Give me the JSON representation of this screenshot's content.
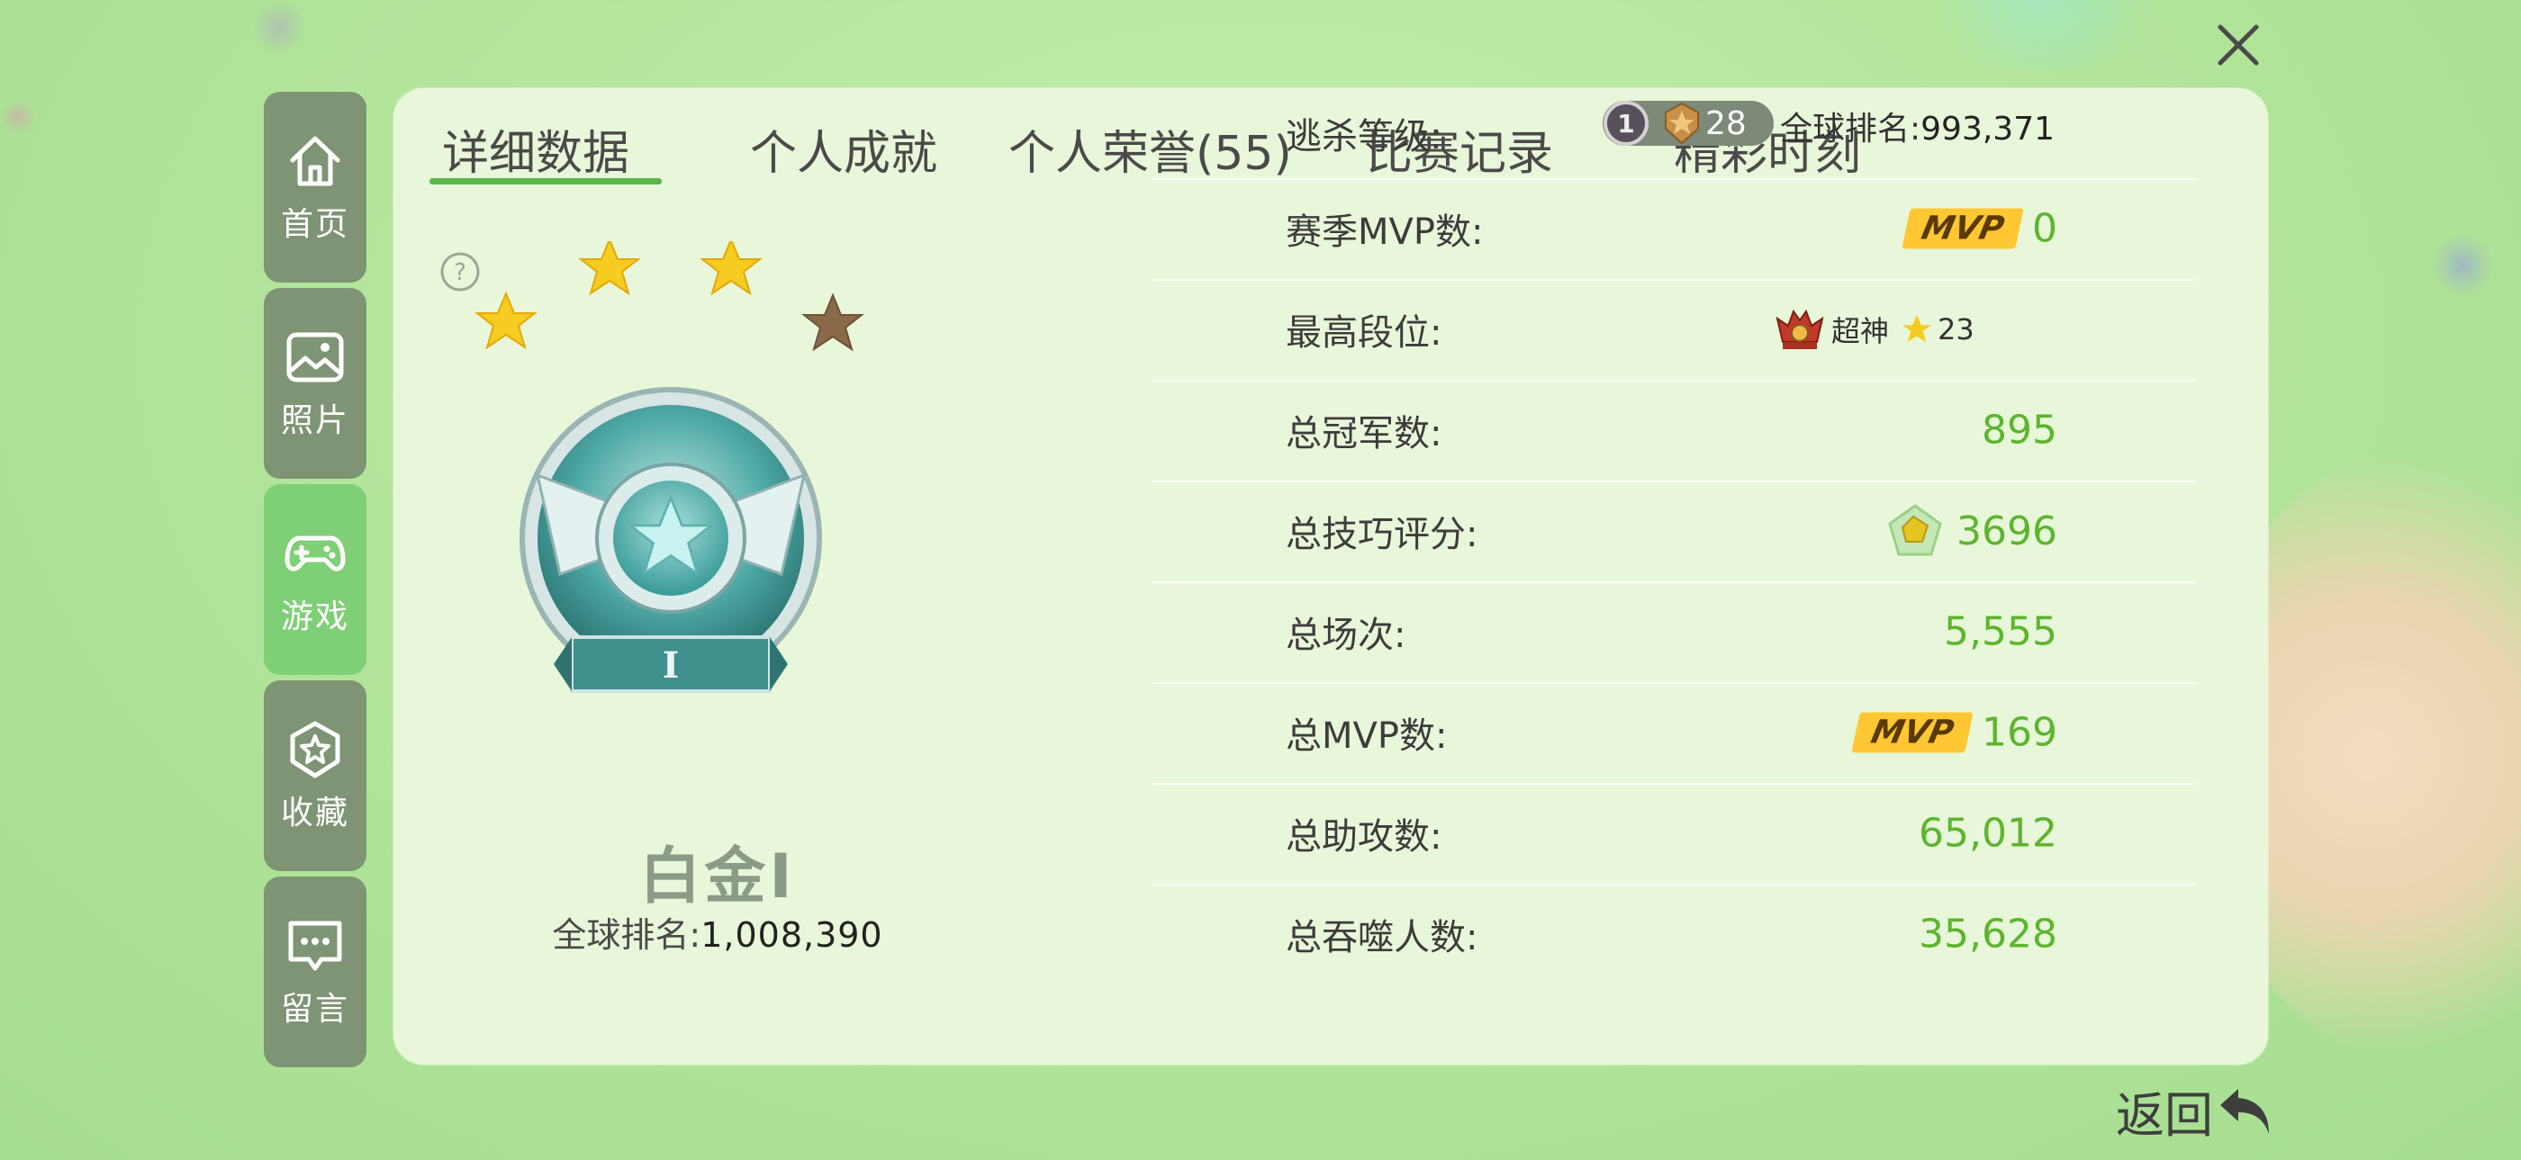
{
  "colors": {
    "accent": "#58b94a",
    "value_green": "#5cb52e",
    "sidebar_bg": "#7f9474",
    "sidebar_active": "#7fcf76",
    "panel_bg": "#e8f7d9",
    "mvp_badge": "#ffc832"
  },
  "sidebar": {
    "items": [
      {
        "label": "首页",
        "icon": "home-icon",
        "active": false
      },
      {
        "label": "照片",
        "icon": "photo-icon",
        "active": false
      },
      {
        "label": "游戏",
        "icon": "gamepad-icon",
        "active": true
      },
      {
        "label": "收藏",
        "icon": "star-badge-icon",
        "active": false
      },
      {
        "label": "留言",
        "icon": "message-icon",
        "active": false
      }
    ]
  },
  "tabs": [
    {
      "label": "详细数据",
      "active": true
    },
    {
      "label": "个人成就",
      "active": false
    },
    {
      "label": "个人荣誉(55)",
      "active": false
    },
    {
      "label": "比赛记录",
      "active": false
    },
    {
      "label": "精彩时刻",
      "active": false
    }
  ],
  "rank": {
    "stars_filled": 4,
    "stars_gold": 3,
    "emblem_numeral": "I",
    "name": "白金Ⅰ",
    "global_label": "全球排名:",
    "global_value": "1,008,390"
  },
  "stats": {
    "level": {
      "label": "逃杀等级:",
      "tier_num": "1",
      "level": "28",
      "global_label": "全球排名:",
      "global_value": "993,371"
    },
    "season_mvp": {
      "label": "赛季MVP数:",
      "badge": "MVP",
      "value": "0"
    },
    "highest": {
      "label": "最高段位:",
      "rank_name": "超神",
      "stars": "23"
    },
    "champions": {
      "label": "总冠军数:",
      "value": "895"
    },
    "skill": {
      "label": "总技巧评分:",
      "value": "3696"
    },
    "games": {
      "label": "总场次:",
      "value": "5,555"
    },
    "mvp_total": {
      "label": "总MVP数:",
      "badge": "MVP",
      "value": "169"
    },
    "assists": {
      "label": "总助攻数:",
      "value": "65,012"
    },
    "devoured": {
      "label": "总吞噬人数:",
      "value": "35,628"
    }
  },
  "back_label": "返回"
}
